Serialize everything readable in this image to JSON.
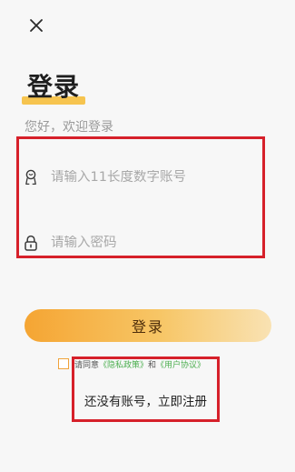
{
  "header": {
    "close_icon": "close-icon"
  },
  "login": {
    "title": "登录",
    "welcome": "您好，欢迎登录",
    "account_placeholder": "请输入11长度数字账号",
    "password_placeholder": "请输入密码",
    "account_icon": "user-icon",
    "password_icon": "lock-icon",
    "submit_label": "登录",
    "agree_prefix": "请同意",
    "privacy_link": "《隐私政策》",
    "agree_and": "和",
    "user_agreement_link": "《用户协议》",
    "register_link": "还没有账号，立即注册"
  },
  "colors": {
    "accent": "#f5a533",
    "title_underline": "#f6c44f",
    "annotation_box": "#d6202a",
    "link_green": "#4caf50",
    "background": "#f7f7f7"
  }
}
